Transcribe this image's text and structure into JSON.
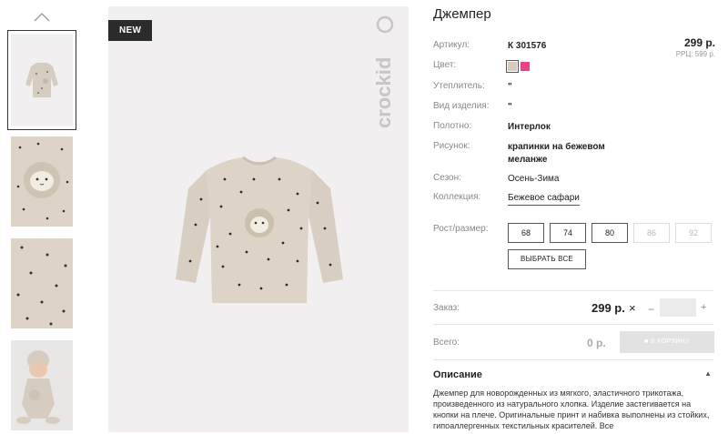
{
  "product": {
    "title": "Джемпер",
    "badge": "NEW",
    "brand": "crockid",
    "price": "299 р.",
    "rrc": "РРЦ: 599 р."
  },
  "specs": {
    "article": {
      "label": "Артикул:",
      "value": "К 301576"
    },
    "color": {
      "label": "Цвет:",
      "swatches": [
        "#d6cbbd",
        "#e94287"
      ]
    },
    "insulation": {
      "label": "Утеплитель:",
      "value": "\""
    },
    "type": {
      "label": "Вид изделия:",
      "value": "\""
    },
    "fabric": {
      "label": "Полотно:",
      "value": "Интерлок"
    },
    "pattern": {
      "label": "Рисунок:",
      "value_line1": "крапинки на бежевом",
      "value_line2": "меланже"
    },
    "season": {
      "label": "Сезон:",
      "value": "Осень-Зима"
    },
    "collection": {
      "label": "Коллекция:",
      "value": "Бежевое сафари"
    }
  },
  "sizes": {
    "label": "Рост/размер:",
    "options": [
      {
        "label": "68",
        "available": true
      },
      {
        "label": "74",
        "available": true
      },
      {
        "label": "80",
        "available": true
      },
      {
        "label": "86",
        "available": false
      },
      {
        "label": "92",
        "available": false
      }
    ],
    "select_all": "ВЫБРАТЬ ВСЕ"
  },
  "order": {
    "label": "Заказ:",
    "price": "299 р.",
    "times": "×",
    "minus": "−",
    "plus": "+",
    "qty": ""
  },
  "total": {
    "label": "Всего:",
    "value": "0 р.",
    "cart_button": "В КОРЗИНУ"
  },
  "description": {
    "title": "Описание",
    "text": "Джемпер для новорожденных из мягкого, эластичного трикотажа, произведенного из натурального хлопка. Изделие застегивается на кнопки на плече. Оригинальные принт и набивка выполнены из стойких, гипоаллергенных текстильных красителей. Все"
  }
}
